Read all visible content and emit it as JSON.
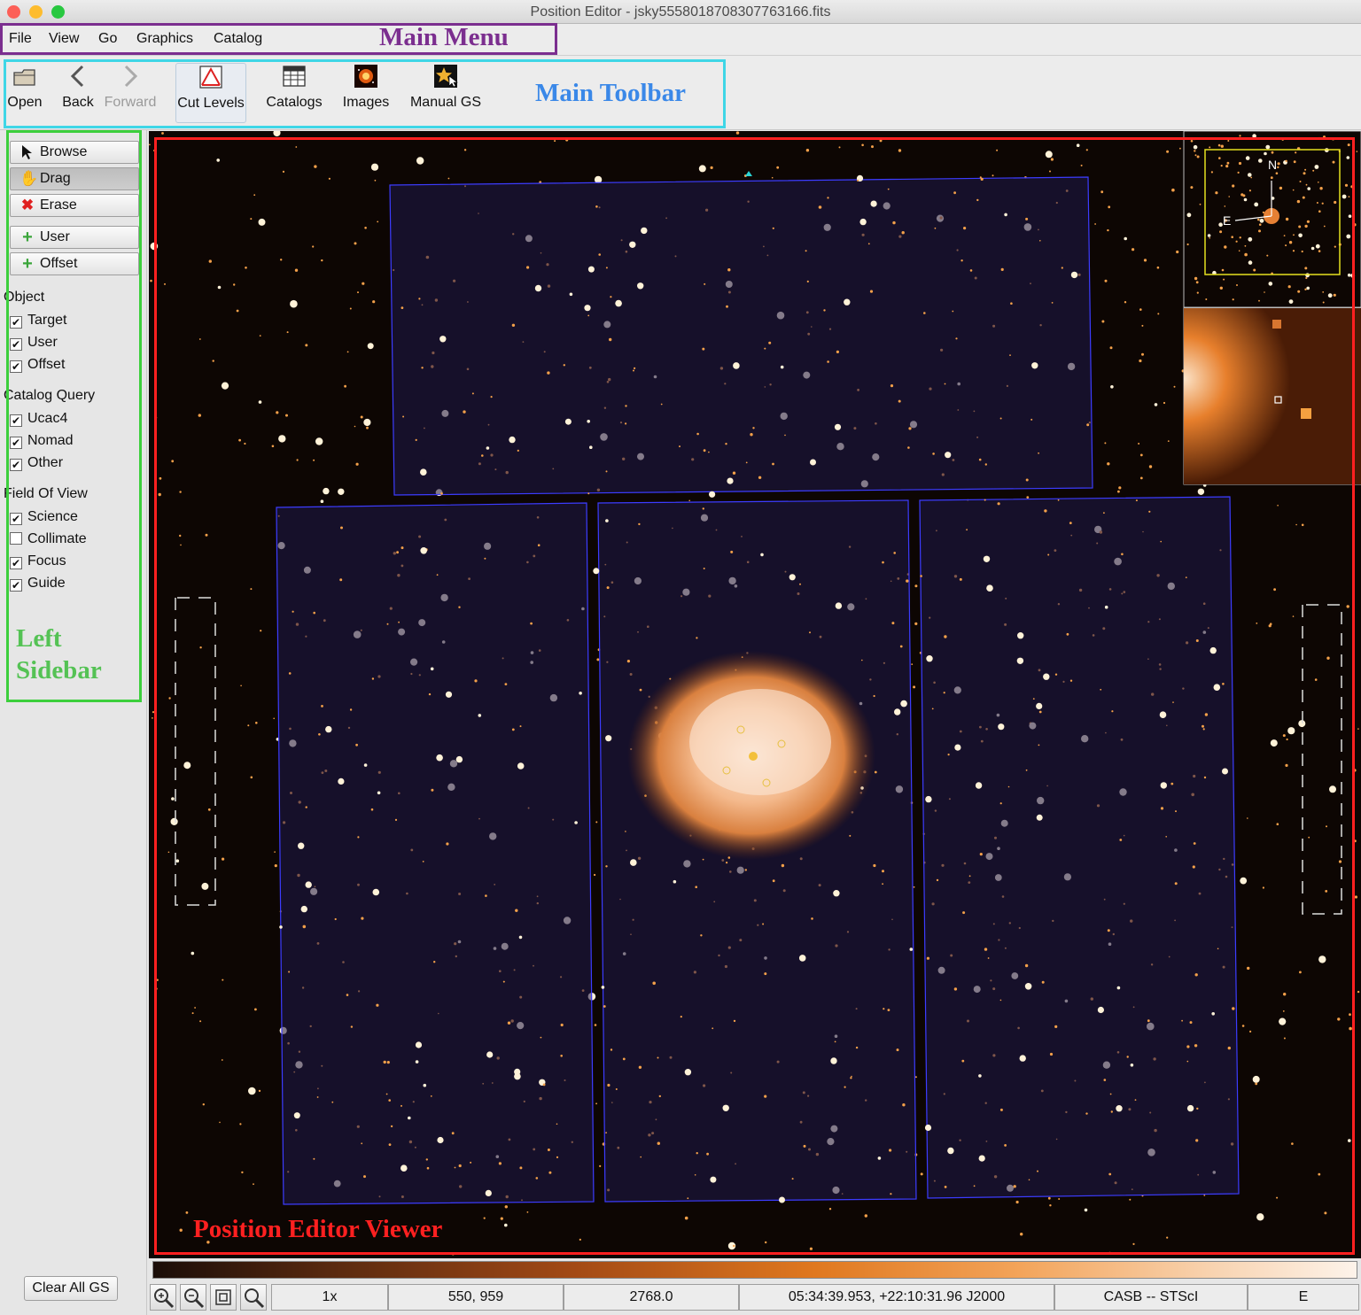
{
  "window": {
    "title": "Position Editor - jsky5558018708307763166.fits"
  },
  "menu": {
    "items": [
      "File",
      "View",
      "Go",
      "Graphics",
      "Catalog"
    ]
  },
  "toolbar": {
    "open": "Open",
    "back": "Back",
    "forward": "Forward",
    "cut_levels": "Cut Levels",
    "catalogs": "Catalogs",
    "images": "Images",
    "manual_gs": "Manual GS"
  },
  "sidebar": {
    "buttons": [
      "Browse",
      "Drag",
      "Erase",
      "User",
      "Offset"
    ],
    "sections": [
      {
        "title": "Object",
        "items": [
          {
            "label": "Target",
            "checked": true
          },
          {
            "label": "User",
            "checked": true
          },
          {
            "label": "Offset",
            "checked": true
          }
        ]
      },
      {
        "title": "Catalog Query",
        "items": [
          {
            "label": "Ucac4",
            "checked": true
          },
          {
            "label": "Nomad",
            "checked": true
          },
          {
            "label": "Other",
            "checked": true
          }
        ]
      },
      {
        "title": "Field Of View",
        "items": [
          {
            "label": "Science",
            "checked": true
          },
          {
            "label": "Collimate",
            "checked": false
          },
          {
            "label": "Focus",
            "checked": true
          },
          {
            "label": "Guide",
            "checked": true
          }
        ]
      }
    ],
    "clear_all_gs": "Clear All GS"
  },
  "annotations": {
    "main_menu": "Main Menu",
    "main_toolbar": "Main Toolbar",
    "left_sidebar_1": "Left",
    "left_sidebar_2": "Sidebar",
    "viewer": "Position Editor Viewer"
  },
  "compass": {
    "north": "N",
    "east": "E"
  },
  "status": {
    "zoom": "1x",
    "pixel": "550, 959",
    "value": "2768.0",
    "coords": "05:34:39.953, +22:10:31.96 J2000",
    "source": "CASB -- STScI",
    "orientation": "E"
  },
  "colors": {
    "main_menu_box": "#7b2e8f",
    "main_toolbar_box": "#3fd6e6",
    "left_sidebar_box": "#3ccf3c",
    "viewer_box": "#ff2020",
    "fov_outline": "#3c3cff",
    "sky": "#0d0603"
  }
}
